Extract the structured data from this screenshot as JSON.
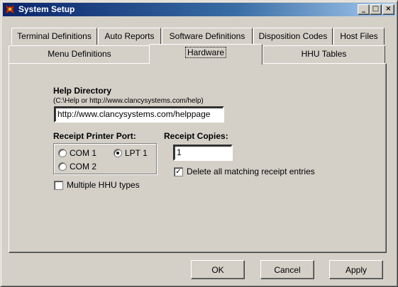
{
  "window": {
    "title": "System Setup",
    "min_label": "_",
    "max_label": "□",
    "close_label": "×"
  },
  "tabs_row1": [
    "Terminal Definitions",
    "Auto Reports",
    "Software Definitions",
    "Disposition Codes",
    "Host Files"
  ],
  "tabs_row2": [
    "Menu Definitions",
    "Hardware",
    "HHU Tables"
  ],
  "hardware": {
    "help_dir_label": "Help Directory",
    "help_dir_hint": "(C:\\Help or http://www.clancysystems.com/help)",
    "help_dir_value": "http://www.clancysystems.com/helppage",
    "printer_port_label": "Receipt Printer Port:",
    "com1": "COM 1",
    "lpt1": "LPT 1",
    "com2": "COM 2",
    "selected_port": "LPT 1",
    "multiple_hhu_label": "Multiple HHU types",
    "multiple_hhu_checked": false,
    "receipt_copies_label": "Receipt Copies:",
    "receipt_copies_value": "1",
    "delete_matching_label": "Delete all matching receipt entries",
    "delete_matching_checked": true
  },
  "buttons": {
    "ok": "OK",
    "cancel": "Cancel",
    "apply": "Apply"
  }
}
